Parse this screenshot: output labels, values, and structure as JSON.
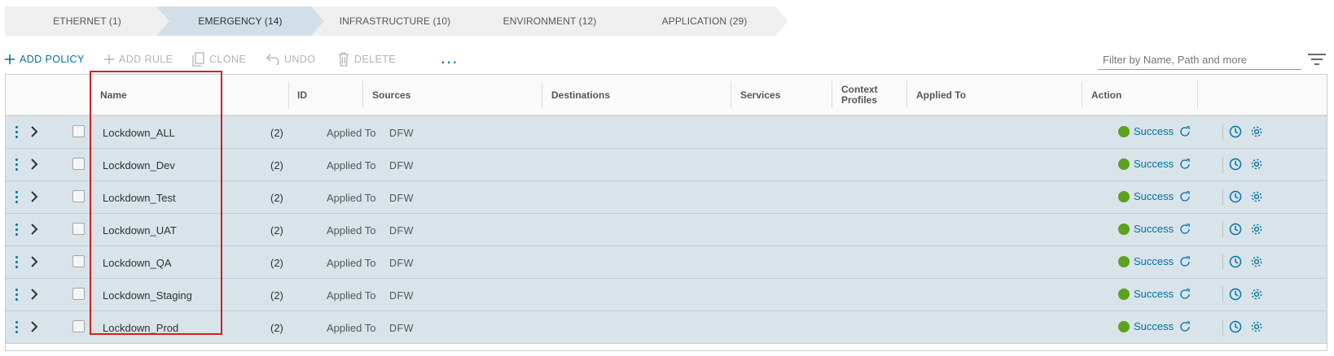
{
  "tabs": [
    {
      "label": "ETHERNET (1)",
      "active": false
    },
    {
      "label": "EMERGENCY (14)",
      "active": true
    },
    {
      "label": "INFRASTRUCTURE (10)",
      "active": false
    },
    {
      "label": "ENVIRONMENT (12)",
      "active": false
    },
    {
      "label": "APPLICATION (29)",
      "active": false
    }
  ],
  "toolbar": {
    "add_policy": "ADD POLICY",
    "add_rule": "ADD RULE",
    "clone": "CLONE",
    "undo": "UNDO",
    "delete": "DELETE",
    "more": "...",
    "filter_placeholder": "Filter by Name, Path and more"
  },
  "columns": {
    "name": "Name",
    "id": "ID",
    "sources": "Sources",
    "destinations": "Destinations",
    "services": "Services",
    "context_profiles_line1": "Context",
    "context_profiles_line2": "Profiles",
    "applied_to": "Applied To",
    "action": "Action"
  },
  "rows": [
    {
      "name": "Lockdown_ALL",
      "count": "(2)",
      "applied_label": "Applied To",
      "applied_value": "DFW",
      "status": "Success"
    },
    {
      "name": "Lockdown_Dev",
      "count": "(2)",
      "applied_label": "Applied To",
      "applied_value": "DFW",
      "status": "Success"
    },
    {
      "name": "Lockdown_Test",
      "count": "(2)",
      "applied_label": "Applied To",
      "applied_value": "DFW",
      "status": "Success"
    },
    {
      "name": "Lockdown_UAT",
      "count": "(2)",
      "applied_label": "Applied To",
      "applied_value": "DFW",
      "status": "Success"
    },
    {
      "name": "Lockdown_QA",
      "count": "(2)",
      "applied_label": "Applied To",
      "applied_value": "DFW",
      "status": "Success"
    },
    {
      "name": "Lockdown_Staging",
      "count": "(2)",
      "applied_label": "Applied To",
      "applied_value": "DFW",
      "status": "Success"
    },
    {
      "name": "Lockdown_Prod",
      "count": "(2)",
      "applied_label": "Applied To",
      "applied_value": "DFW",
      "status": "Success"
    }
  ],
  "icons": {
    "row_menu": "vertical-ellipsis-icon",
    "row_expand": "chevron-right-icon",
    "status": "success-dot-icon",
    "refresh": "refresh-icon",
    "history": "clock-icon",
    "settings": "gear-icon",
    "filter": "filter-icon"
  },
  "colors": {
    "accent": "#0072a3",
    "success": "#5aa220",
    "row_bg": "#d8e3ea",
    "active_tab": "#d0dfe8",
    "highlight": "#d32020"
  }
}
